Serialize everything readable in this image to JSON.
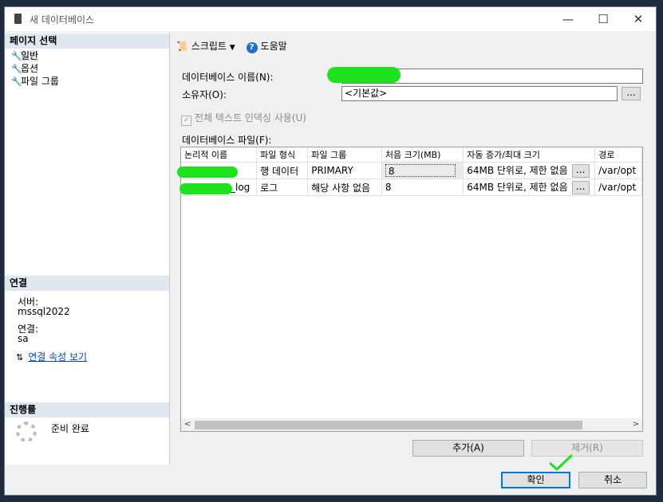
{
  "window": {
    "title": "새 데이터베이스",
    "icon": "database-window-icon",
    "minimize": "—",
    "maximize": "☐",
    "close": "✕"
  },
  "left_pane": {
    "pages_header": "페이지 선택",
    "pages": [
      {
        "label": "일반",
        "icon": "wrench-icon",
        "selected": true
      },
      {
        "label": "옵션",
        "icon": "wrench-icon",
        "selected": false
      },
      {
        "label": "파일 그룹",
        "icon": "wrench-icon",
        "selected": false
      }
    ],
    "connection_header": "연결",
    "server_label": "서버:",
    "server_value": "mssql2022",
    "conn_label": "연결:",
    "conn_value": "sa",
    "conn_link": "연결 속성 보기",
    "progress_header": "진행률",
    "progress_status": "준비 완료"
  },
  "toolbar": {
    "script_label": "스크립트",
    "help_label": "도움말"
  },
  "form": {
    "db_name_label": "데이터베이스 이름(N):",
    "db_name_value": "",
    "owner_label": "소유자(O):",
    "owner_value": "<기본값>",
    "owner_browse": "...",
    "fulltext_label": "전체 텍스트 인덱싱 사용(U)",
    "fulltext_checked": true,
    "files_label": "데이터베이스 파일(F):"
  },
  "files_table": {
    "columns": [
      "논리적 이름",
      "파일 형식",
      "파일 그룹",
      "처음 크기(MB)",
      "자동 증가/최대 크기",
      "경로"
    ],
    "rows": [
      {
        "name": "",
        "type": "행 데이터",
        "group": "PRIMARY",
        "size": "8",
        "growth": "64MB 단위로, 제한 없음",
        "path": "/var/opt"
      },
      {
        "name": "_log",
        "type": "로그",
        "group": "해당 사항 없음",
        "size": "8",
        "growth": "64MB 단위로, 제한 없음",
        "path": "/var/opt"
      }
    ],
    "cell_button": "...",
    "scroll_left": "<",
    "scroll_right": ">"
  },
  "buttons": {
    "add": "추가(A)",
    "remove": "제거(R)",
    "ok": "확인",
    "cancel": "취소"
  },
  "colors": {
    "redaction": "#1fe21f",
    "accent": "#0078d7",
    "section_header": "#dfe8f0"
  }
}
